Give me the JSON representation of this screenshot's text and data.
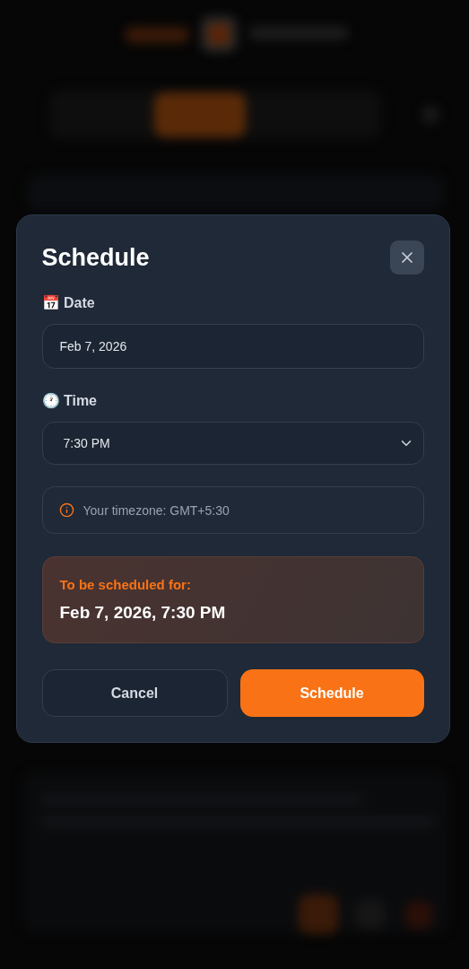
{
  "dialog": {
    "title": "Schedule",
    "date": {
      "label": "📅 Date",
      "value": "Feb 7, 2026"
    },
    "time": {
      "label": "🕐 Time",
      "value": "7:30 PM"
    },
    "timezone_note": "Your timezone: GMT+5:30",
    "summary": {
      "caption": "To be scheduled for:",
      "value": "Feb 7, 2026, 7:30 PM"
    },
    "buttons": [
      {
        "label": "Cancel",
        "kind": "secondary"
      },
      {
        "label": "Schedule",
        "kind": "primary"
      }
    ]
  }
}
